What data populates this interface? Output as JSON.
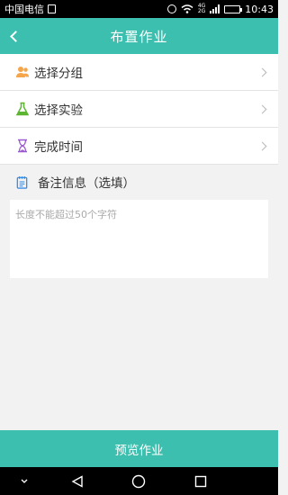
{
  "status_bar": {
    "carrier": "中国电信",
    "network_top": "4G",
    "network_bottom": "2G",
    "time": "10:43"
  },
  "header": {
    "title": "布置作业"
  },
  "menu": {
    "items": [
      {
        "label": "选择分组",
        "icon": "group-icon"
      },
      {
        "label": "选择实验",
        "icon": "flask-icon"
      },
      {
        "label": "完成时间",
        "icon": "hourglass-icon"
      }
    ]
  },
  "notes": {
    "label": "备注信息（选填）",
    "placeholder": "长度不能超过50个字符",
    "value": ""
  },
  "footer": {
    "preview_label": "预览作业"
  },
  "colors": {
    "accent": "#3cbfae",
    "group_icon": "#f5a54a",
    "flask_icon": "#5cb531",
    "hourglass_icon": "#9b59d0",
    "notes_icon": "#3a8ee6"
  }
}
